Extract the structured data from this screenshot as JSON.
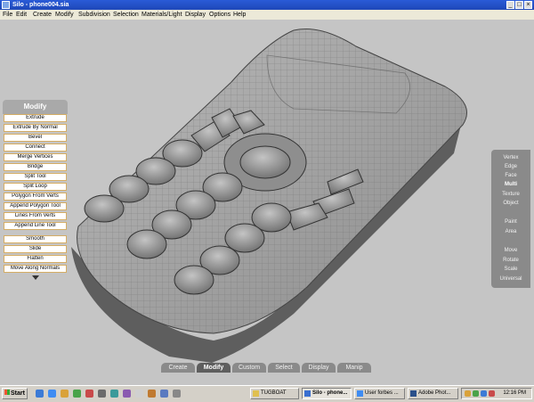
{
  "window": {
    "title": "Silo - phone004.sia",
    "min": "_",
    "max": "□",
    "close": "×"
  },
  "menu": [
    "File",
    "Edit",
    "Create",
    "Modify",
    "Subdivision",
    "Selection",
    "Materials/Light",
    "Display",
    "Options",
    "Help"
  ],
  "modify_panel": {
    "header": "Modify",
    "group1": [
      "Extrude",
      "Extrude By Normal",
      "Bevel",
      "Connect",
      "Merge Vertices",
      "Bridge",
      "Split Tool",
      "Split Loop",
      "Polygon From Verts",
      "Append Polygon Tool",
      "Lines From Verts",
      "Append Line Tool"
    ],
    "group2": [
      "Smooth",
      "Slide",
      "Flatten",
      "Move Along Normals"
    ]
  },
  "select_panel": {
    "group1": [
      "Vertex",
      "Edge",
      "Face",
      "Multi",
      "Texture",
      "Object"
    ],
    "active": "Multi",
    "group2": [
      "Paint",
      "Area"
    ],
    "group3": [
      "Move",
      "Rotate",
      "Scale",
      "Universal"
    ]
  },
  "bottom_tabs": {
    "items": [
      "Create",
      "Modify",
      "Custom",
      "Select",
      "Display",
      "Manip"
    ],
    "active": "Modify"
  },
  "taskbar": {
    "start": "Start",
    "tasks": [
      "TUGBOAT",
      "Silo - phone...",
      "User forbes ...",
      "Adobe Phot..."
    ],
    "active_task": "Silo - phone...",
    "clock": "12:16 PM"
  },
  "colors": {
    "titlebar": "#1f48b8",
    "viewport": "#c5c5c5",
    "button_border": "#d5ad65",
    "panel": "#8a8a8a"
  }
}
